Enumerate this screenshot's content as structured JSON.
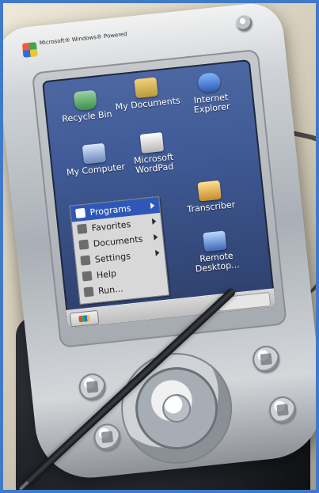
{
  "device": {
    "brand_text": "Microsoft® Windows® Powered"
  },
  "desktop": {
    "icons": [
      {
        "label": "Recycle Bin",
        "icon": "recycle-bin-icon"
      },
      {
        "label": "My Documents",
        "icon": "my-documents-icon"
      },
      {
        "label": "Internet Explorer",
        "icon": "internet-explorer-icon"
      },
      {
        "label": "My Computer",
        "icon": "my-computer-icon"
      },
      {
        "label": "Microsoft WordPad",
        "icon": "microsoft-wordpad-icon"
      },
      {
        "label": "Transcriber",
        "icon": "transcriber-icon"
      },
      {
        "label": "Remote Desktop...",
        "icon": "remote-desktop-icon"
      }
    ]
  },
  "start_menu": {
    "items": [
      {
        "label": "Programs",
        "has_submenu": true,
        "icon": "programs-icon"
      },
      {
        "label": "Favorites",
        "has_submenu": true,
        "icon": "favorites-icon"
      },
      {
        "label": "Documents",
        "has_submenu": true,
        "icon": "documents-icon"
      },
      {
        "label": "Settings",
        "has_submenu": true,
        "icon": "settings-icon"
      },
      {
        "label": "Help",
        "has_submenu": false,
        "icon": "help-icon"
      },
      {
        "label": "Run...",
        "has_submenu": false,
        "icon": "run-icon"
      }
    ]
  }
}
